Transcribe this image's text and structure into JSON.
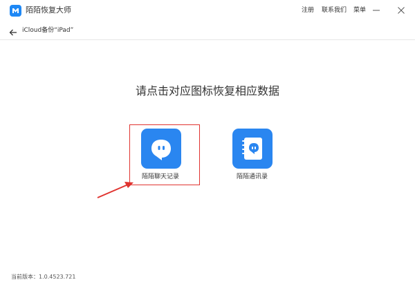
{
  "app": {
    "title": "陌陌恢复大师",
    "menu": [
      "注册",
      "联系我们",
      "菜单"
    ]
  },
  "subheader": {
    "breadcrumb": "iCloud备份“iPad”"
  },
  "main": {
    "heading": "请点击对应图标恢复相应数据",
    "options": [
      {
        "label": "陌陌聊天记录",
        "icon": "chat-bubble-icon",
        "highlighted": true
      },
      {
        "label": "陌陌通讯录",
        "icon": "contact-book-icon",
        "highlighted": false
      }
    ]
  },
  "footer": {
    "version_label": "当前版本：",
    "version_number": "1.0.4523.721"
  },
  "colors": {
    "accent": "#2a86f0",
    "highlight": "#e0332f"
  }
}
